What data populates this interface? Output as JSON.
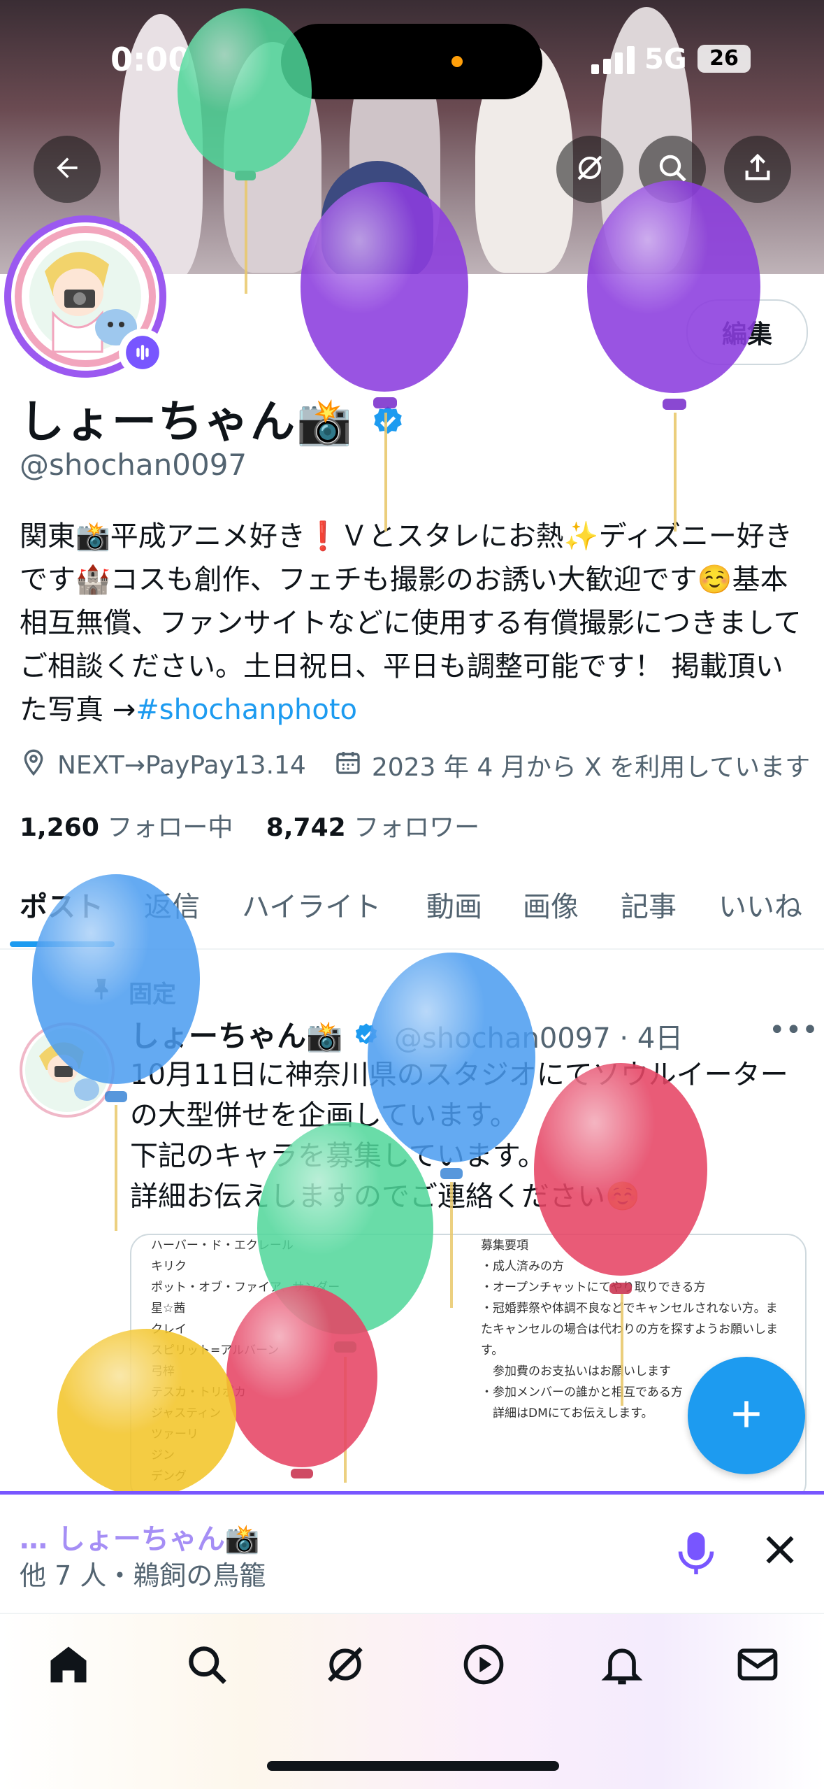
{
  "status_bar": {
    "time": "0:00",
    "network": "5G",
    "battery": "26"
  },
  "header": {
    "edit_label": "編集"
  },
  "profile": {
    "name": "しょーちゃん📸",
    "handle": "@shochan0097",
    "bio_text": "関東📸平成アニメ好き❗️Ｖとスタレにお熱✨ディズニー好きです🏰コスも創作、フェチも撮影のお誘い大歓迎です☺️基本相互無償、ファンサイトなどに使用する有償撮影につきましてご相談ください。土日祝日、平日も調整可能です！ 掲載頂いた写真 →",
    "bio_hashtag": "#shochanphoto",
    "location": "NEXT→PayPay13.14",
    "joined": "2023 年 4 月から X を利用しています",
    "following_count": "1,260",
    "following_label": "フォロー中",
    "followers_count": "8,742",
    "followers_label": "フォロワー"
  },
  "tabs": [
    "ポスト",
    "返信",
    "ハイライト",
    "動画",
    "画像",
    "記事",
    "いいね"
  ],
  "pinned_post": {
    "pinned_label": "固定",
    "author": "しょーちゃん📸",
    "handle_time": "@shochan0097 · 4日",
    "text_lines": [
      "10月11日に神奈川県のスタジオにてソウルイーターの大型併せを企画しています。",
      "下記のキャラを募集しています。",
      "詳細お伝えしますのでご連絡ください☺️"
    ],
    "image_left": "ハーバー・ド・エクレール\nキリク\nポット・オブ・ファイア、サンダー\n星☆茜\nクレイ\nスピリット=アルバーン\n弓梓\nテスカ・トリポカ\nジャスティン\nツァーリ\nジン\nデング",
    "image_right": "募集要項\n・成人済みの方\n・オープンチャットにてやり取りできる方\n・冠婚葬祭や体調不良などでキャンセルされない方。またキャンセルの場合は代わりの方を探すようお願いします。\n　参加費のお支払いはお願いします\n・参加メンバーの誰かと相互である方\n　詳細はDMにてお伝えします。"
  },
  "space": {
    "host": "… しょーちゃん📸",
    "subtitle": "他 7 人・鵜飼の鳥籠"
  },
  "icons": [
    "back-arrow-icon",
    "grok-icon",
    "search-icon",
    "share-icon",
    "verified-icon",
    "location-icon",
    "calendar-icon",
    "pin-icon",
    "more-icon",
    "plus-icon",
    "mic-icon",
    "close-icon",
    "home-icon",
    "explore-icon",
    "video-icon",
    "bell-icon",
    "mail-icon"
  ],
  "colors": {
    "accent": "#1d9bf0",
    "spaces": "#7856ff",
    "text": "#0f1419",
    "muted": "#536471"
  }
}
